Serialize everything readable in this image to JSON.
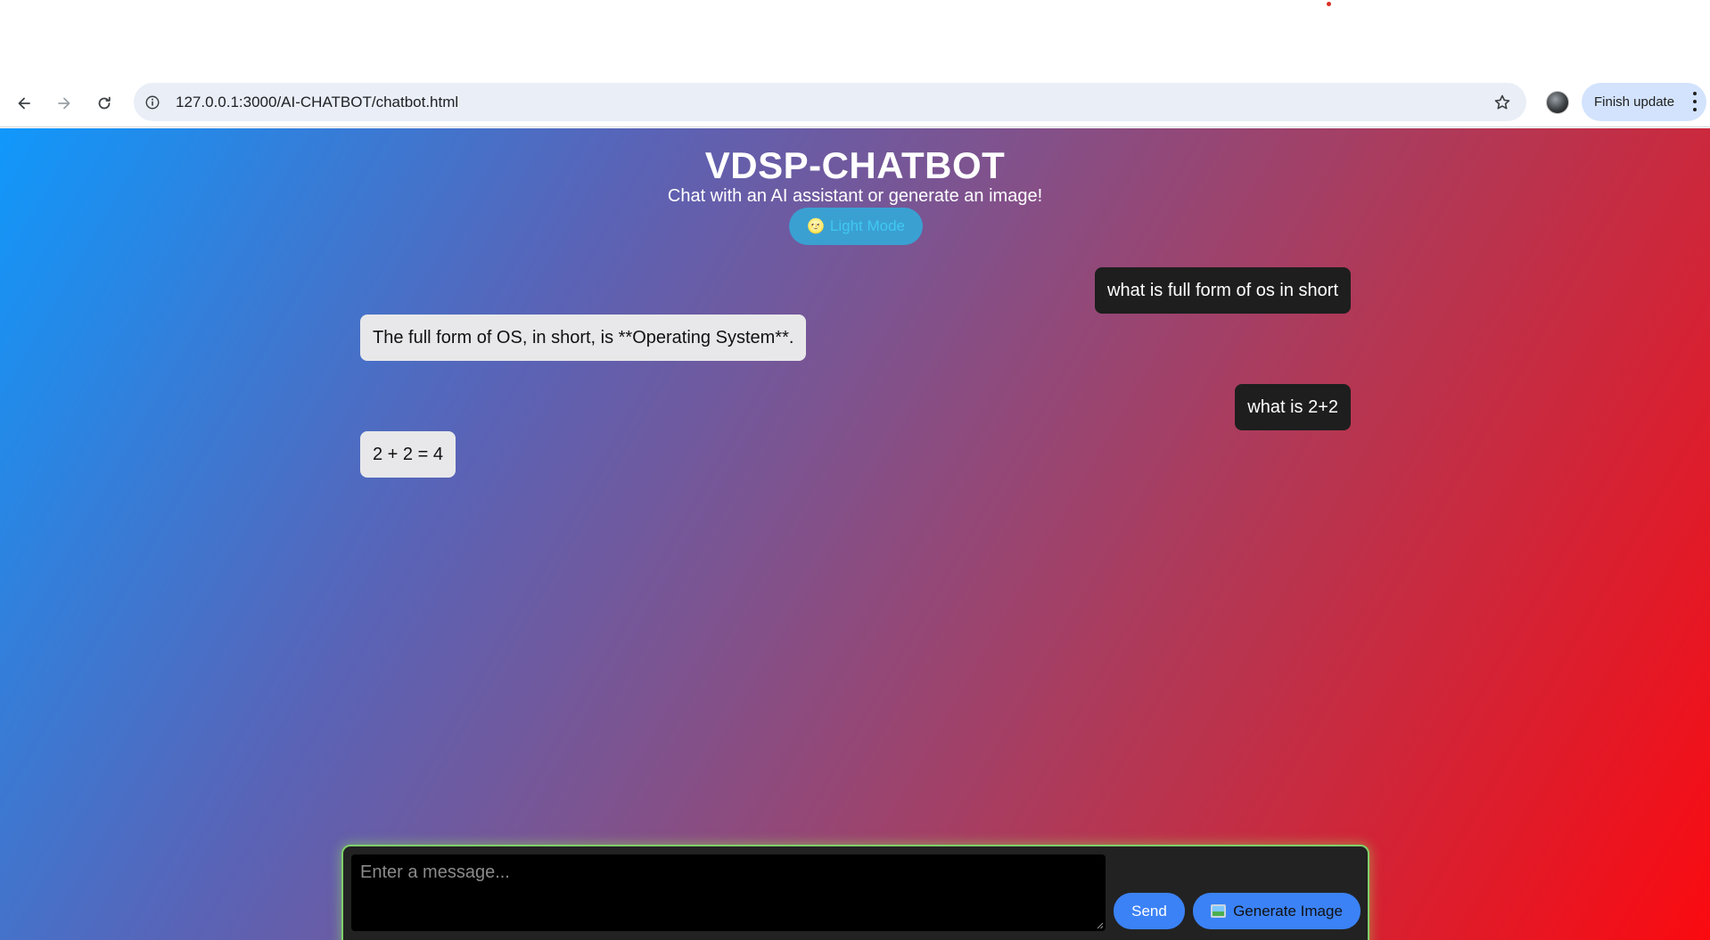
{
  "browser": {
    "url": "127.0.0.1:3000/AI-CHATBOT/chatbot.html",
    "update_label": "Finish update",
    "icons": [
      "back-arrow-icon",
      "forward-arrow-icon",
      "reload-icon",
      "site-info-icon",
      "bookmark-star-icon",
      "profile-avatar",
      "more-vert-icon"
    ]
  },
  "header": {
    "title": "VDSP-CHATBOT",
    "subtitle": "Chat with an AI assistant or generate an image!",
    "mode_emoji": "🌝",
    "mode_label": "Light Mode"
  },
  "messages": [
    {
      "role": "user",
      "text": "what is full form of os in short"
    },
    {
      "role": "bot",
      "text": "The full form of OS, in short, is **Operating System**."
    },
    {
      "role": "user",
      "text": "what is 2+2"
    },
    {
      "role": "bot",
      "text": "2 + 2 = 4"
    }
  ],
  "composer": {
    "placeholder": "Enter a message...",
    "send_label": "Send",
    "generate_label": "Generate Image",
    "generate_icon": "framed-picture-icon"
  },
  "colors": {
    "gradient_start": "#1098fb",
    "gradient_end": "#fb0a10",
    "user_bubble": "#1e1e1e",
    "bot_bubble": "#e8e8ea",
    "button_blue": "#3b82f6",
    "input_glow": "#7fd06a"
  }
}
